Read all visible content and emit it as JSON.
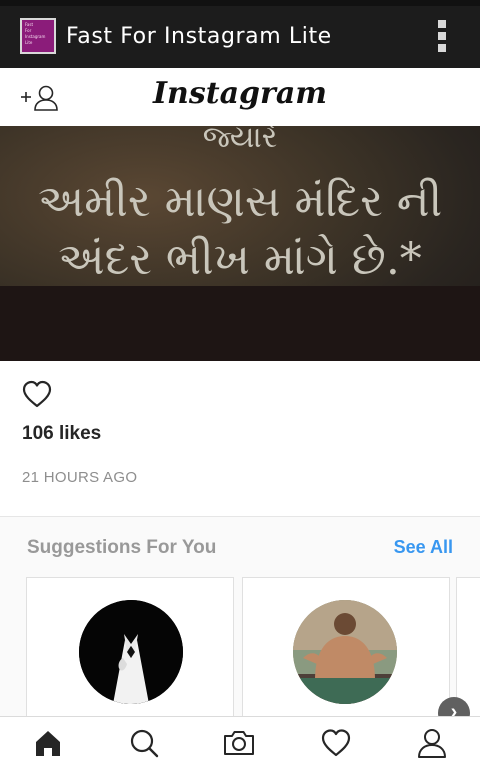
{
  "app_bar": {
    "title": "Fast For Instagram Lite",
    "icon_label_lines": [
      "Fast",
      "For",
      "Instagram",
      "Lite"
    ],
    "icons": {
      "app": "app-icon",
      "menu": "overflow-menu-icon"
    },
    "background": "#1c1c1c"
  },
  "header": {
    "logo": "Instagram",
    "icons": {
      "add": "add-person-icon"
    }
  },
  "post": {
    "image_text_lines": [
      "જ્યારે",
      "અમીર માણસ મંદિર ની",
      "અંદર ભીખ માંગે છે.*"
    ],
    "likes": "106 likes",
    "time_ago": "21 HOURS AGO",
    "icons": {
      "like": "heart-icon"
    }
  },
  "suggestions": {
    "title": "Suggestions For You",
    "see_all": "See All",
    "cards": [
      {
        "avatar": "tuxedo-avatar"
      },
      {
        "avatar": "person-photo-avatar"
      }
    ],
    "next": "›"
  },
  "bottom_nav": {
    "items": [
      "home-icon",
      "search-icon",
      "camera-icon",
      "heart-icon",
      "profile-icon"
    ],
    "active": "home-icon"
  },
  "colors": {
    "link": "#3897f0",
    "muted": "#8e8e8e",
    "text": "#262626"
  }
}
